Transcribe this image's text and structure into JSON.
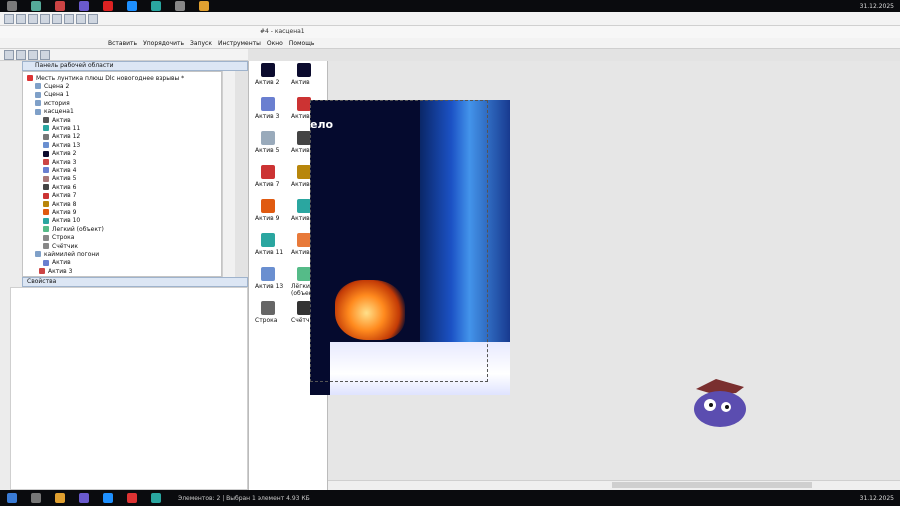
{
  "taskbar_top": {
    "clock": "31.12.2025"
  },
  "taskbar_bottom": {
    "clock": "31.12.2025"
  },
  "window": {
    "title": "#4 - касцена1"
  },
  "menu": [
    "Вставить",
    "Упорядочить",
    "Запуск",
    "Инструменты",
    "Окно",
    "Помощь"
  ],
  "workspace": {
    "header": "Панель рабочей области"
  },
  "tree": [
    {
      "label": "Месть лунтика плюш Dlc новогоднее взрывы *",
      "indent": 0,
      "color": "#d33"
    },
    {
      "label": "Сцена 2",
      "indent": 2,
      "color": "#7fa0c8"
    },
    {
      "label": "Сцена 1",
      "indent": 2,
      "color": "#7fa0c8"
    },
    {
      "label": "история",
      "indent": 2,
      "color": "#7fa0c8"
    },
    {
      "label": "касцена1",
      "indent": 2,
      "color": "#7fa0c8"
    },
    {
      "label": "Актив",
      "indent": 4,
      "color": "#555"
    },
    {
      "label": "Актив 11",
      "indent": 4,
      "color": "#2aa6a0"
    },
    {
      "label": "Актив 12",
      "indent": 4,
      "color": "#777"
    },
    {
      "label": "Актив 13",
      "indent": 4,
      "color": "#6a8fd0"
    },
    {
      "label": "Актив 2",
      "indent": 4,
      "color": "#0b0b2e"
    },
    {
      "label": "Актив 3",
      "indent": 4,
      "color": "#c44"
    },
    {
      "label": "Актив 4",
      "indent": 4,
      "color": "#6a7fd0"
    },
    {
      "label": "Актив 5",
      "indent": 4,
      "color": "#a77"
    },
    {
      "label": "Актив 6",
      "indent": 4,
      "color": "#444"
    },
    {
      "label": "Актив 7",
      "indent": 4,
      "color": "#c33"
    },
    {
      "label": "Актив 8",
      "indent": 4,
      "color": "#b8860b"
    },
    {
      "label": "Актив 9",
      "indent": 4,
      "color": "#e05a10"
    },
    {
      "label": "Актив 10",
      "indent": 4,
      "color": "#2aa6a0"
    },
    {
      "label": "Легкий (объект)",
      "indent": 4,
      "color": "#5b8"
    },
    {
      "label": "Строка",
      "indent": 4,
      "color": "#888"
    },
    {
      "label": "Счётчик",
      "indent": 4,
      "color": "#888"
    },
    {
      "label": "каймилей погони",
      "indent": 2,
      "color": "#7fa0c8"
    },
    {
      "label": "Актив",
      "indent": 4,
      "color": "#6a7fd0"
    },
    {
      "label": "Актив 3",
      "indent": 3,
      "color": "#c44"
    }
  ],
  "properties": {
    "header": "Свойства"
  },
  "objects": [
    {
      "label": "Актив 2",
      "color": "#0b0b2e"
    },
    {
      "label": "Актив 3",
      "color": "#6a7fd0"
    },
    {
      "label": "Актив 5",
      "color": "#9ab"
    },
    {
      "label": "Актив 7",
      "color": "#c33"
    },
    {
      "label": "Актив 9",
      "color": "#e05a10"
    },
    {
      "label": "Актив 11",
      "color": "#2aa6a0"
    },
    {
      "label": "Актив 13",
      "color": "#6a8fd0"
    },
    {
      "label": "Строка",
      "color": "#666"
    },
    {
      "label": "Актив",
      "color": "#0b0b2e"
    },
    {
      "label": "Актив 4",
      "color": "#c33"
    },
    {
      "label": "Актив 6",
      "color": "#444"
    },
    {
      "label": "Актив 8",
      "color": "#b8860b"
    },
    {
      "label": "Актив 10",
      "color": "#2aa6a0"
    },
    {
      "label": "Актив 12",
      "color": "#e87a3a"
    },
    {
      "label": "Лёгкий (объект)",
      "color": "#5b8"
    },
    {
      "label": "Счётчик",
      "color": "#333"
    }
  ],
  "scene": {
    "text": "ело"
  },
  "statusbar": {
    "text": "Элементов: 2 | Выбран 1 элемент 4.93 КБ"
  }
}
